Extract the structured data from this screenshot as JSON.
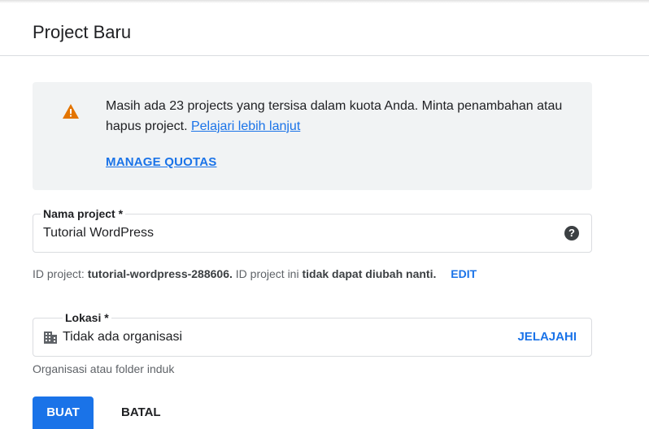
{
  "header": {
    "title": "Project Baru"
  },
  "quota_notice": {
    "message": "Masih ada 23 projects yang tersisa dalam kuota Anda. Minta penambahan atau hapus project.",
    "learn_more": "Pelajari lebih lanjut",
    "manage_quotas": "MANAGE QUOTAS",
    "icon": "warning-icon",
    "icon_color": "#e37400"
  },
  "project_name": {
    "label": "Nama project *",
    "value": "Tutorial WordPress",
    "help_icon": "help-icon"
  },
  "project_id": {
    "prefix": "ID project:",
    "id": "tutorial-wordpress-288606.",
    "middle": "ID project ini",
    "emphasis": "tidak dapat diubah nanti.",
    "edit_label": "EDIT"
  },
  "location": {
    "label": "Lokasi *",
    "value": "Tidak ada organisasi",
    "browse_label": "JELAJAHI",
    "helper": "Organisasi atau folder induk",
    "icon": "organization-icon"
  },
  "actions": {
    "create_label": "BUAT",
    "cancel_label": "BATAL"
  },
  "colors": {
    "accent": "#1a73e8",
    "notice_bg": "#f1f3f4",
    "warning": "#e37400"
  }
}
